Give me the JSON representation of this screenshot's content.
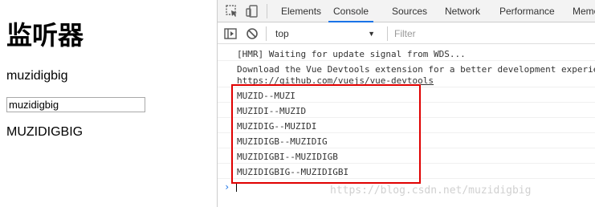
{
  "page": {
    "title": "监听器",
    "message": "muzidigbig",
    "input_value": "muzidigbig",
    "upper": "MUZIDIGBIG"
  },
  "devtools": {
    "tabs": [
      {
        "label": "Elements"
      },
      {
        "label": "Console"
      },
      {
        "label": "Sources"
      },
      {
        "label": "Network"
      },
      {
        "label": "Performance"
      },
      {
        "label": "Memo"
      }
    ],
    "active_tab": "Console",
    "context": "top",
    "filter_placeholder": "Filter",
    "console": {
      "messages": [
        {
          "text": "[HMR] Waiting for update signal from WDS..."
        },
        {
          "text": "Download the Vue Devtools extension for a better development experie"
        },
        {
          "text": "https://github.com/vuejs/vue-devtools"
        },
        {
          "text": "MUZID--MUZI"
        },
        {
          "text": "MUZIDI--MUZID"
        },
        {
          "text": "MUZIDIG--MUZIDI"
        },
        {
          "text": "MUZIDIGB--MUZIDIG"
        },
        {
          "text": "MUZIDIGBI--MUZIDIGB"
        },
        {
          "text": "MUZIDIGBIG--MUZIDIGBI"
        }
      ],
      "prompt": "›"
    }
  },
  "watermark": "https://blog.csdn.net/muzidigbig",
  "colors": {
    "highlight": "#e00000",
    "active_tab_underline": "#1a73e8"
  }
}
